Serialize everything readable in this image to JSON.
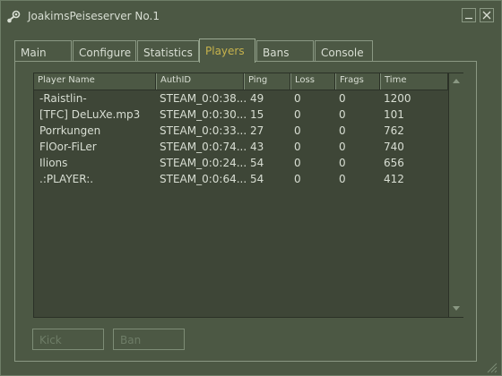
{
  "window": {
    "title": "JoakimsPeiseserver No.1"
  },
  "icons": {
    "app": "steam-icon",
    "minimize": "minimize-icon",
    "close": "close-icon",
    "scroll_up": "scroll-up-arrow-icon",
    "scroll_down": "scroll-down-arrow-icon",
    "resize": "resize-grip-icon"
  },
  "colors": {
    "background": "#4c5844",
    "list_background": "#3e4637",
    "text": "#d8ded3",
    "active_tab_text": "#c6b24c",
    "disabled_text": "#6e7d67"
  },
  "tabs": [
    {
      "label": "Main"
    },
    {
      "label": "Configure"
    },
    {
      "label": "Statistics"
    },
    {
      "label": "Players",
      "active": true
    },
    {
      "label": "Bans"
    },
    {
      "label": "Console"
    }
  ],
  "players": {
    "columns": [
      "Player Name",
      "AuthID",
      "Ping",
      "Loss",
      "Frags",
      "Time"
    ],
    "rows": [
      {
        "name": "-Raistlin-",
        "authid": "STEAM_0:0:38...",
        "ping": "49",
        "loss": "0",
        "frags": "0",
        "time": "1200"
      },
      {
        "name": "[TFC] DeLuXe.mp3",
        "authid": "STEAM_0:0:30...",
        "ping": "15",
        "loss": "0",
        "frags": "0",
        "time": "101"
      },
      {
        "name": "Porrkungen",
        "authid": "STEAM_0:0:33...",
        "ping": "27",
        "loss": "0",
        "frags": "0",
        "time": "762"
      },
      {
        "name": "FlOor-FiLer",
        "authid": "STEAM_0:0:74...",
        "ping": "43",
        "loss": "0",
        "frags": "0",
        "time": "740"
      },
      {
        "name": "Ilions",
        "authid": "STEAM_0:0:24...",
        "ping": "54",
        "loss": "0",
        "frags": "0",
        "time": "656"
      },
      {
        "name": ".:PLAYER:.",
        "authid": "STEAM_0:0:64...",
        "ping": "54",
        "loss": "0",
        "frags": "0",
        "time": "412"
      }
    ]
  },
  "buttons": {
    "kick": "Kick",
    "ban": "Ban"
  }
}
